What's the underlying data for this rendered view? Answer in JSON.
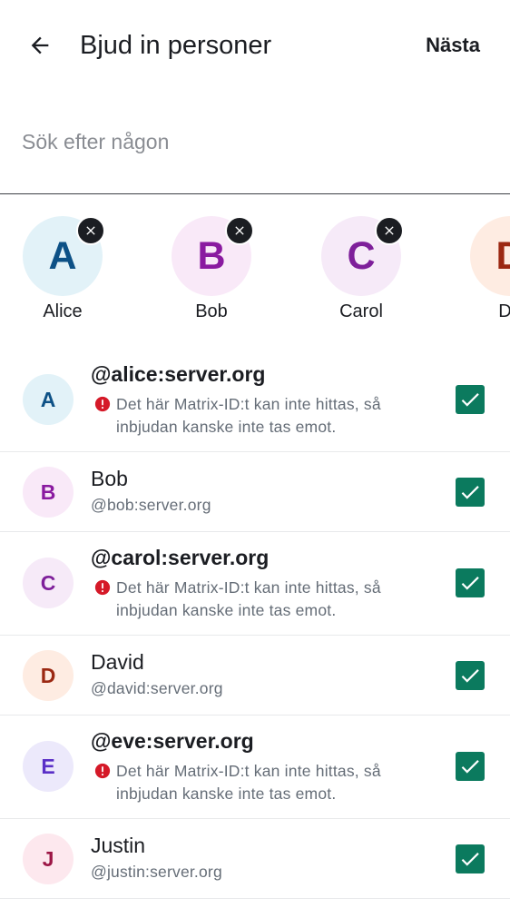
{
  "header": {
    "title": "Bjud in personer",
    "next_label": "Nästa"
  },
  "search": {
    "placeholder": "Sök efter någon"
  },
  "colors": {
    "accent_checkbox": "#0b7a5e",
    "warning_red": "#d51928"
  },
  "selected_chips": [
    {
      "initial": "A",
      "name": "Alice",
      "bg": "#e2f2f8",
      "fg": "#0d5186"
    },
    {
      "initial": "B",
      "name": "Bob",
      "bg": "#f9e9f8",
      "fg": "#8a1aa0"
    },
    {
      "initial": "C",
      "name": "Carol",
      "bg": "#f6eaf8",
      "fg": "#7e1f9a"
    },
    {
      "initial": "D",
      "name": "Da",
      "bg": "#feece2",
      "fg": "#9b2812"
    }
  ],
  "warning_text": "Det här Matrix-ID:t kan inte hittas, så inbjudan kanske inte tas emot.",
  "users": [
    {
      "initial": "A",
      "title": "@alice:server.org",
      "subtitle": "",
      "has_warning": true,
      "checked": true,
      "bg": "#e2f2f8",
      "fg": "#0d5186"
    },
    {
      "initial": "B",
      "title": "Bob",
      "subtitle": "@bob:server.org",
      "has_warning": false,
      "checked": true,
      "bg": "#f9e9f8",
      "fg": "#8a1aa0"
    },
    {
      "initial": "C",
      "title": "@carol:server.org",
      "subtitle": "",
      "has_warning": true,
      "checked": true,
      "bg": "#f6eaf8",
      "fg": "#7e1f9a"
    },
    {
      "initial": "D",
      "title": "David",
      "subtitle": "@david:server.org",
      "has_warning": false,
      "checked": true,
      "bg": "#feece2",
      "fg": "#9b2812"
    },
    {
      "initial": "E",
      "title": "@eve:server.org",
      "subtitle": "",
      "has_warning": true,
      "checked": true,
      "bg": "#ece9fb",
      "fg": "#5a2fc7"
    },
    {
      "initial": "J",
      "title": "Justin",
      "subtitle": "@justin:server.org",
      "has_warning": false,
      "checked": true,
      "bg": "#fde8ee",
      "fg": "#9c1645"
    }
  ]
}
